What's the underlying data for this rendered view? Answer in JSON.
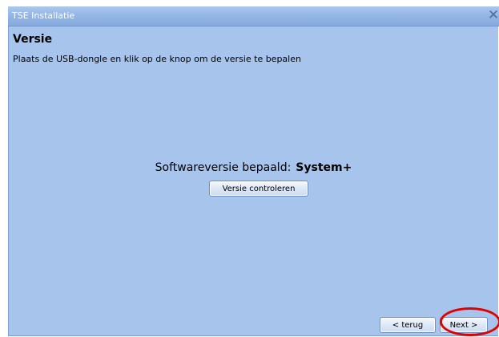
{
  "window": {
    "title": "TSE Installatie",
    "close_icon": "close-icon",
    "colors": {
      "titlebar": "#92b5e4",
      "body": "#a7c4ec",
      "highlight": "#e00000"
    }
  },
  "page": {
    "heading": "Versie",
    "subtitle": "Plaats de USB-dongle en klik op de knop om de versie te bepalen",
    "version_label": "Softwareversie bepaald:",
    "version_value": "System+",
    "check_button": "Versie controleren"
  },
  "footer": {
    "back_button": "< terug",
    "next_button": "Next >"
  }
}
